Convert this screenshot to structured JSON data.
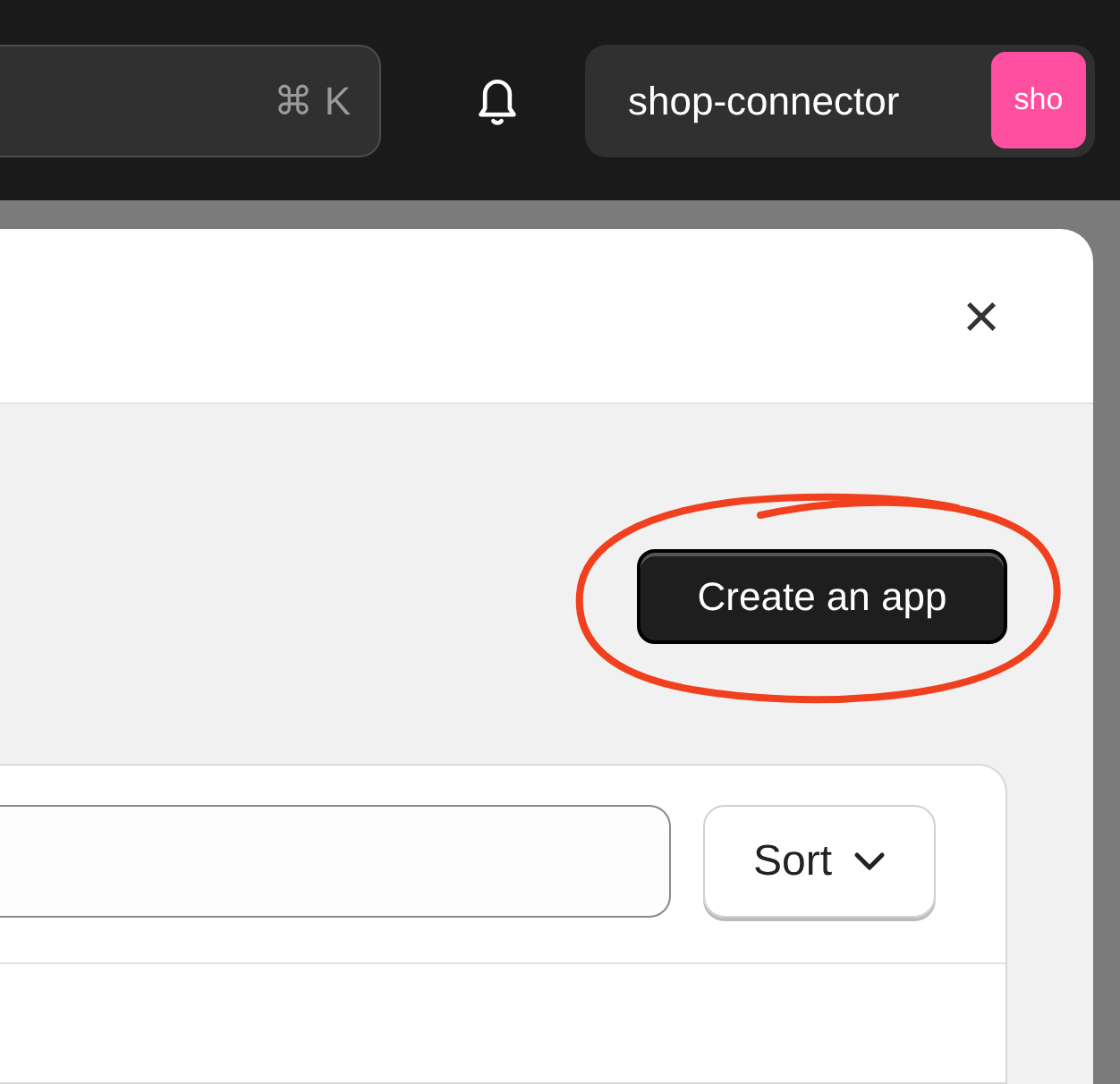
{
  "top_bar": {
    "search": {
      "shortcut": "⌘ K"
    },
    "store": {
      "name": "shop-connector",
      "avatar": "sho"
    }
  },
  "modal": {
    "close": "×",
    "create_button": "Create an app",
    "sort_button": "Sort"
  }
}
